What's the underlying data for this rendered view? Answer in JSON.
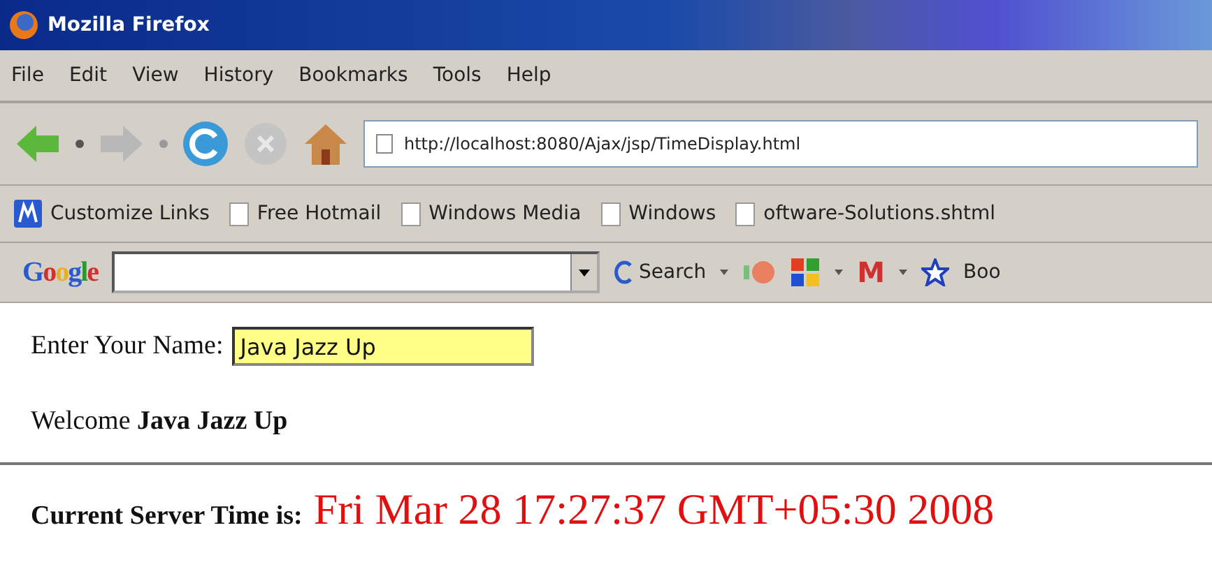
{
  "window": {
    "title": "Mozilla Firefox"
  },
  "menu": [
    {
      "label": "File"
    },
    {
      "label": "Edit"
    },
    {
      "label": "View"
    },
    {
      "label": "History"
    },
    {
      "label": "Bookmarks"
    },
    {
      "label": "Tools"
    },
    {
      "label": "Help"
    }
  ],
  "address_bar": {
    "url": "http://localhost:8080/Ajax/jsp/TimeDisplay.html"
  },
  "bookmarks": [
    {
      "label": "Customize Links",
      "kind": "logo"
    },
    {
      "label": "Free Hotmail",
      "kind": "page"
    },
    {
      "label": "Windows Media",
      "kind": "page"
    },
    {
      "label": "Windows",
      "kind": "page"
    },
    {
      "label": "oftware-Solutions.shtml",
      "kind": "page"
    }
  ],
  "google_toolbar": {
    "logo": "Google",
    "search_button": "Search",
    "mail_logo": "M",
    "bookmarks_label": "Boo"
  },
  "page": {
    "name_label": "Enter Your Name:",
    "name_value": "Java Jazz Up",
    "welcome": "Welcome **Java Jazz Up**",
    "time_label": "Current Server Time is:",
    "time_value": "Fri Mar 28 17:27:37 GMT+05:30 2008"
  }
}
